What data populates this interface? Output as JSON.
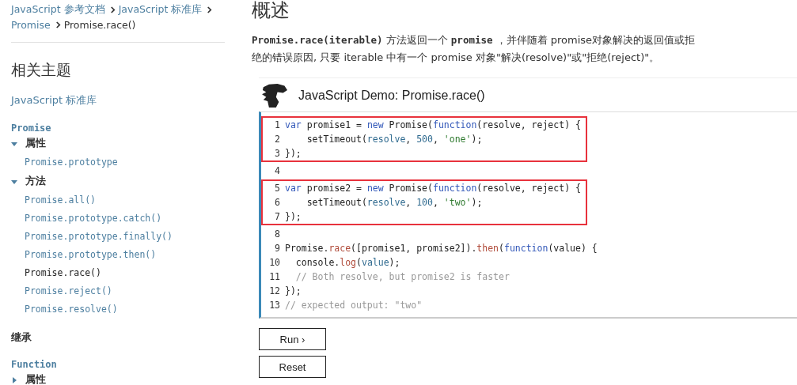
{
  "breadcrumb": [
    {
      "label": "JavaScript 参考文档",
      "current": false
    },
    {
      "label": "JavaScript 标准库",
      "current": false
    },
    {
      "label": "Promise",
      "current": false
    },
    {
      "label": "Promise.race()",
      "current": true
    }
  ],
  "sidebar": {
    "title": "相关主题",
    "sections": [
      {
        "kind": "link",
        "label": "JavaScript 标准库"
      },
      {
        "kind": "group",
        "title": "Promise",
        "folders": [
          {
            "label": "属性",
            "expanded": true,
            "children": [
              {
                "label": "Promise.prototype",
                "selected": false
              }
            ]
          },
          {
            "label": "方法",
            "expanded": true,
            "children": [
              {
                "label": "Promise.all()",
                "selected": false
              },
              {
                "label": "Promise.prototype.catch()",
                "selected": false
              },
              {
                "label": "Promise.prototype.finally()",
                "selected": false
              },
              {
                "label": "Promise.prototype.then()",
                "selected": false
              },
              {
                "label": "Promise.race()",
                "selected": true
              },
              {
                "label": "Promise.reject()",
                "selected": false
              },
              {
                "label": "Promise.resolve()",
                "selected": false
              }
            ]
          }
        ]
      },
      {
        "kind": "heading",
        "label": "继承"
      },
      {
        "kind": "group",
        "title": "Function",
        "folders": [
          {
            "label": "属性",
            "expanded": false
          }
        ]
      }
    ]
  },
  "main": {
    "heading": "概述",
    "summary": "**Promise.race(iterable)** 方法返回一个 **promise** ，并伴随着 promise对象解决的返回值或拒绝的错误原因, 只要 iterable 中有一个 promise 对象\"解决(resolve)\"或\"拒绝(reject)\"。",
    "demo": {
      "title": "JavaScript Demo: Promise.race()",
      "groups": [
        {
          "highlighted": true,
          "lines": [
            {
              "number": "1",
              "tokens": [
                {
                  "kind": "keyword",
                  "text": "var"
                },
                {
                  "kind": "plain",
                  "text": " promise1 = "
                },
                {
                  "kind": "keyword",
                  "text": "new"
                },
                {
                  "kind": "plain",
                  "text": " Promise("
                },
                {
                  "kind": "keyword",
                  "text": "function"
                },
                {
                  "kind": "plain",
                  "text": "(resolve, reject) {"
                }
              ]
            },
            {
              "number": "2",
              "tokens": [
                {
                  "kind": "plain",
                  "text": "    setTimeout("
                },
                {
                  "kind": "variable",
                  "text": "resolve"
                },
                {
                  "kind": "plain",
                  "text": ", "
                },
                {
                  "kind": "number",
                  "text": "500"
                },
                {
                  "kind": "plain",
                  "text": ", "
                },
                {
                  "kind": "string",
                  "text": "'one'"
                },
                {
                  "kind": "plain",
                  "text": ");"
                }
              ]
            },
            {
              "number": "3",
              "tokens": [
                {
                  "kind": "plain",
                  "text": "});"
                }
              ]
            }
          ]
        },
        {
          "highlighted": false,
          "lines": [
            {
              "number": "4"
            }
          ]
        },
        {
          "highlighted": true,
          "lines": [
            {
              "number": "5",
              "tokens": [
                {
                  "kind": "keyword",
                  "text": "var"
                },
                {
                  "kind": "plain",
                  "text": " promise2 = "
                },
                {
                  "kind": "keyword",
                  "text": "new"
                },
                {
                  "kind": "plain",
                  "text": " Promise("
                },
                {
                  "kind": "keyword",
                  "text": "function"
                },
                {
                  "kind": "plain",
                  "text": "(resolve, reject) {"
                }
              ]
            },
            {
              "number": "6",
              "tokens": [
                {
                  "kind": "plain",
                  "text": "    setTimeout("
                },
                {
                  "kind": "variable",
                  "text": "resolve"
                },
                {
                  "kind": "plain",
                  "text": ", "
                },
                {
                  "kind": "number",
                  "text": "100"
                },
                {
                  "kind": "plain",
                  "text": ", "
                },
                {
                  "kind": "string",
                  "text": "'two'"
                },
                {
                  "kind": "plain",
                  "text": ");"
                }
              ]
            },
            {
              "number": "7",
              "tokens": [
                {
                  "kind": "plain",
                  "text": "});"
                }
              ]
            }
          ]
        },
        {
          "highlighted": false,
          "lines": [
            {
              "number": "8"
            },
            {
              "number": "9",
              "tokens": [
                {
                  "kind": "plain",
                  "text": "Promise."
                },
                {
                  "kind": "property",
                  "text": "race"
                },
                {
                  "kind": "plain",
                  "text": "([promise1, promise2])."
                },
                {
                  "kind": "property",
                  "text": "then"
                },
                {
                  "kind": "plain",
                  "text": "("
                },
                {
                  "kind": "keyword",
                  "text": "function"
                },
                {
                  "kind": "plain",
                  "text": "(value) {"
                }
              ]
            },
            {
              "number": "10",
              "tokens": [
                {
                  "kind": "plain",
                  "text": "  console."
                },
                {
                  "kind": "property",
                  "text": "log"
                },
                {
                  "kind": "plain",
                  "text": "("
                },
                {
                  "kind": "variable",
                  "text": "value"
                },
                {
                  "kind": "plain",
                  "text": ");"
                }
              ]
            },
            {
              "number": "11",
              "tokens": [
                {
                  "kind": "comment",
                  "text": "  // Both resolve, but promise2 is faster"
                }
              ]
            },
            {
              "number": "12",
              "tokens": [
                {
                  "kind": "plain",
                  "text": "});"
                }
              ]
            },
            {
              "number": "13",
              "tokens": [
                {
                  "kind": "comment",
                  "text": "// expected output: \"two\""
                }
              ]
            }
          ]
        }
      ],
      "buttons": [
        {
          "label": "Run ›"
        },
        {
          "label": "Reset"
        }
      ]
    }
  }
}
